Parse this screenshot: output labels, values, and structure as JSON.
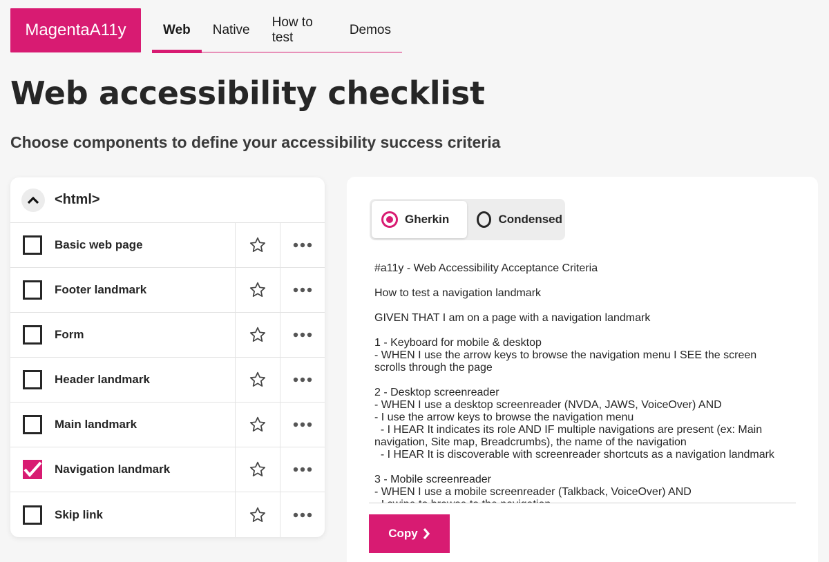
{
  "header": {
    "logo": "MagentaA11y",
    "nav": [
      {
        "label": "Web",
        "active": true
      },
      {
        "label": "Native",
        "active": false
      },
      {
        "label": "How to test",
        "active": false
      },
      {
        "label": "Demos",
        "active": false
      }
    ]
  },
  "page": {
    "title": "Web accessibility checklist",
    "subtitle": "Choose components to define your accessibility success criteria"
  },
  "checklist": {
    "group_title": "<html>",
    "items": [
      {
        "label": "Basic web page",
        "checked": false
      },
      {
        "label": "Footer landmark",
        "checked": false
      },
      {
        "label": "Form",
        "checked": false
      },
      {
        "label": "Header landmark",
        "checked": false
      },
      {
        "label": "Main landmark",
        "checked": false
      },
      {
        "label": "Navigation landmark",
        "checked": true
      },
      {
        "label": "Skip link",
        "checked": false
      }
    ]
  },
  "output": {
    "format_options": [
      {
        "label": "Gherkin",
        "selected": true
      },
      {
        "label": "Condensed",
        "selected": false
      }
    ],
    "criteria_lines": [
      "#a11y - Web Accessibility Acceptance Criteria",
      "",
      "How to test a navigation landmark",
      "",
      "GIVEN THAT I am on a page with a navigation landmark",
      "",
      "1 - Keyboard for mobile & desktop",
      "- WHEN I use the arrow keys to browse the navigation menu I SEE the screen",
      "scrolls through the page",
      "",
      "2 - Desktop screenreader",
      "- WHEN I use a desktop screenreader (NVDA, JAWS, VoiceOver) AND",
      "- I use the arrow keys to browse the navigation menu",
      "  - I HEAR It indicates its role AND IF multiple navigations are present (ex: Main",
      "navigation, Site map, Breadcrumbs), the name of the navigation",
      "  - I HEAR It is discoverable with screenreader shortcuts as a navigation landmark",
      "",
      "3 - Mobile screenreader",
      "- WHEN I use a mobile screenreader (Talkback, VoiceOver) AND",
      "- I swipe to browse to the navigation"
    ],
    "copy_label": "Copy"
  },
  "colors": {
    "brand": "#d81b72",
    "text": "#262626",
    "background": "#f6f6f6"
  }
}
